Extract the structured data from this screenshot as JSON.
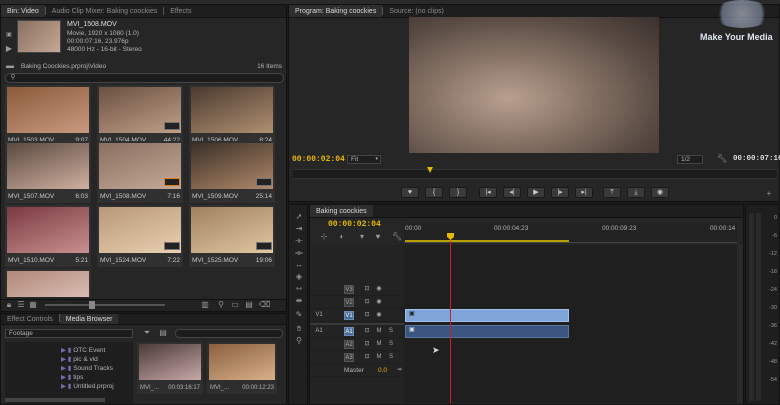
{
  "top_bar": {
    "title_fragment": "(unlabeled top bar)"
  },
  "left_panel": {
    "tabs": [
      "Bin: Video",
      "Audio Clip Mixer: Baking coockies",
      "Effects"
    ],
    "preview": {
      "name": "MVI_1508.MOV",
      "line1": "Movie, 1920 x 1080 (1.0)",
      "line2": "00:00:07:16, 23.976p",
      "line3": "48000 Hz - 16-bit - Stereo"
    },
    "bin_path": "Baking Coockies.prproj\\Video",
    "item_count": "16 Items",
    "clips": [
      {
        "name": "MVI_1503.MOV",
        "dur": "9:07",
        "c1": "#8a5a3a",
        "c2": "#c99a80"
      },
      {
        "name": "MVI_1504.MOV",
        "dur": "44:22",
        "c1": "#6a5040",
        "c2": "#c0a088"
      },
      {
        "name": "MVI_1506.MOV",
        "dur": "8:24",
        "c1": "#4a3a30",
        "c2": "#b09070"
      },
      {
        "name": "MVI_1507.MOV",
        "dur": "6:03",
        "c1": "#5a4a40",
        "c2": "#d0b0a0"
      },
      {
        "name": "MVI_1508.MOV",
        "dur": "7:16",
        "c1": "#8a7060",
        "c2": "#c4a898"
      },
      {
        "name": "MVI_1509.MOV",
        "dur": "25:14",
        "c1": "#3a3028",
        "c2": "#b08868"
      },
      {
        "name": "MVI_1510.MOV",
        "dur": "5:21",
        "c1": "#7a3a40",
        "c2": "#c89090"
      },
      {
        "name": "MVI_1524.MOV",
        "dur": "7:22",
        "c1": "#b89878",
        "c2": "#e8d0b0"
      },
      {
        "name": "MVI_1525.MOV",
        "dur": "19:06",
        "c1": "#a08060",
        "c2": "#e0c8a0"
      },
      {
        "name": "",
        "dur": "",
        "c1": "#b08878",
        "c2": "#e8d0c8"
      }
    ]
  },
  "bottom_left": {
    "tabs": [
      "Effect Controls",
      "Media Browser"
    ],
    "dropdown": "Footage",
    "tree": [
      "OTC Event",
      "pic & vid",
      "Sound Tracks",
      "tips",
      "Untitled.prproj"
    ],
    "media": [
      {
        "name": "MVI_...",
        "dur": "00:03:16:17",
        "c1": "#4a3a38",
        "c2": "#c8a8a8"
      },
      {
        "name": "MVI_...",
        "dur": "00:00:12:23",
        "c1": "#8a6040",
        "c2": "#d8b088"
      }
    ]
  },
  "program": {
    "tabs": [
      "Program: Baking coockies",
      "Source: (no clips)"
    ],
    "timecode": "00:00:02:04",
    "fit": "Fit",
    "res": "1/2",
    "duration": "00:00:07:16"
  },
  "watermark": "Make Your Media",
  "timeline": {
    "tab": "Baking coockies",
    "timecode": "00:00:02:04",
    "ruler": [
      "00:00",
      "00:00:04:23",
      "00:00:09:23",
      "00:00:14"
    ],
    "video_tracks": [
      "V3",
      "V2",
      "V1"
    ],
    "audio_tracks": [
      "A1",
      "A2",
      "A3"
    ],
    "master_label": "Master",
    "master_val": "0.0",
    "src_v": "V1",
    "src_a": "A1"
  },
  "vu_scale": [
    "0",
    "-6",
    "-12",
    "-18",
    "-24",
    "-30",
    "-36",
    "-42",
    "-48",
    "-54"
  ]
}
